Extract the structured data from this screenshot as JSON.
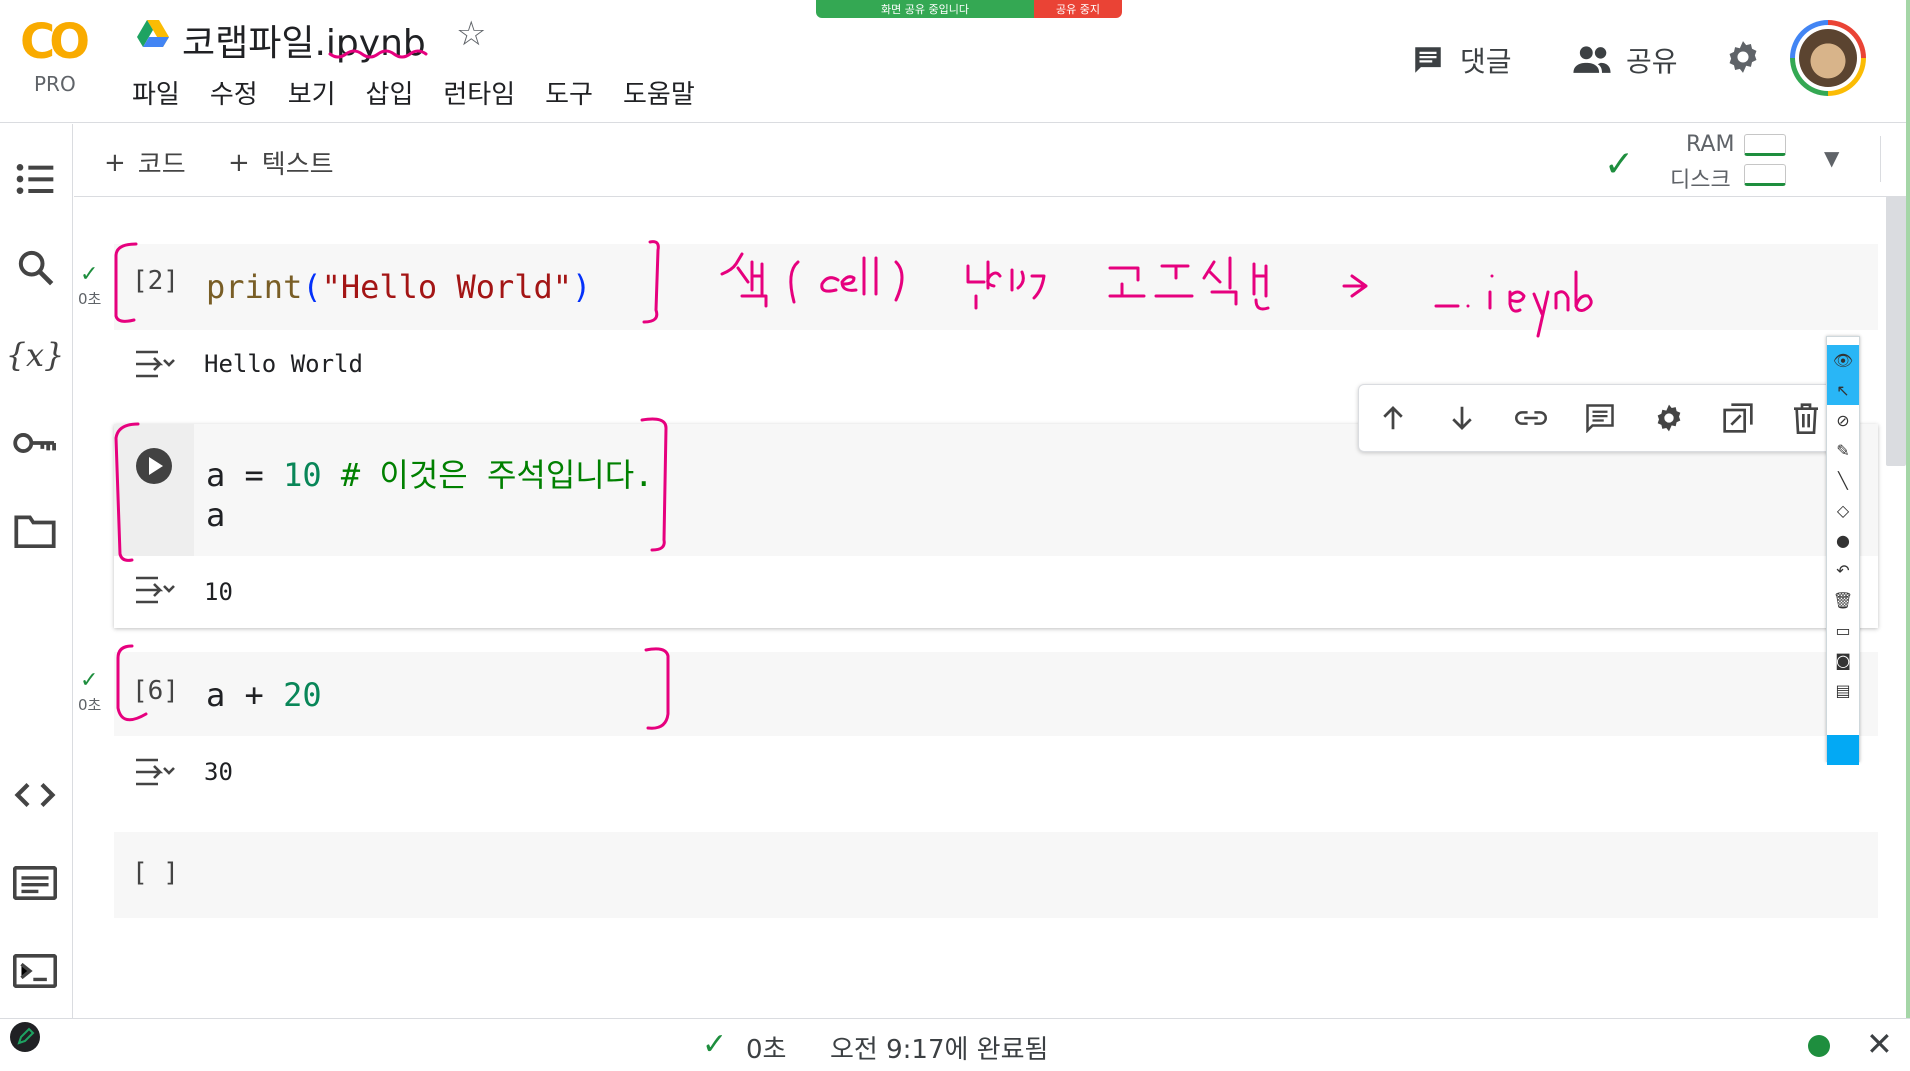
{
  "app": {
    "logo_text": "CO",
    "logo_badge": "PRO",
    "notebook_title": "코랩파일.ipynb"
  },
  "menu": [
    "파일",
    "수정",
    "보기",
    "삽입",
    "런타임",
    "도구",
    "도움말"
  ],
  "share_banner": {
    "sharing_text": "화면 공유 중입니다",
    "stop_text": "공유 중지"
  },
  "header_actions": {
    "comment_label": "댓글",
    "share_label": "공유"
  },
  "toolbar": {
    "add_code_label": "코드",
    "add_text_label": "텍스트",
    "ram_label": "RAM",
    "disk_label": "디스크"
  },
  "cells": [
    {
      "prompt": "[2]",
      "exec_time": "0초",
      "output": "Hello World"
    },
    {
      "prompt": "",
      "code_line2": "a",
      "output": "10"
    },
    {
      "prompt": "[6]",
      "exec_time": "0초",
      "output": "30"
    },
    {
      "prompt": "[ ]"
    }
  ],
  "code_tokens": {
    "c1_fn": "print",
    "c1_open": "(",
    "c1_str": "\"Hello World\"",
    "c1_close": ")",
    "c2_var": "a = ",
    "c2_num": "10",
    "c2_comment": " # 이것은 주석입니다.",
    "c3_var": "a + ",
    "c3_num": "20"
  },
  "status": {
    "time": "0초",
    "message": "오전 9:17에 완료됨"
  },
  "colors": {
    "annotation": "#e6007e",
    "colab_orange": "#f9ab00",
    "success_green": "#1e8e3e"
  },
  "icons": {
    "sidebar": [
      "toc-icon",
      "search-icon",
      "variables-icon",
      "secrets-key-icon",
      "files-folder-icon",
      "code-snippets-icon",
      "command-palette-icon",
      "terminal-icon"
    ],
    "cell_toolbar": [
      "move-up-icon",
      "move-down-icon",
      "link-icon",
      "comment-icon",
      "settings-icon",
      "mirror-cell-icon",
      "delete-icon"
    ]
  }
}
